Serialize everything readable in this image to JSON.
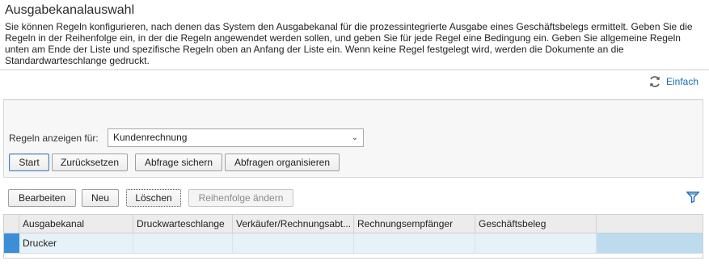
{
  "page": {
    "title": "Ausgabekanalauswahl",
    "description": "Sie können Regeln konfigurieren, nach denen das System den Ausgabekanal für die prozessintegrierte Ausgabe eines Geschäftsbelegs ermittelt. Geben Sie die Regeln in der Reihenfolge ein, in der die Regeln angewendet werden sollen, und geben Sie für jede Regel eine Bedingung ein. Geben Sie allgemeine Regeln unten am Ende der Liste und spezifische Regeln oben an Anfang der Liste ein. Wenn keine Regel festgelegt wird, werden die Dokumente an die Standardwarteschlange gedruckt."
  },
  "simple_link": {
    "label": "Einfach",
    "icon": "refresh-icon"
  },
  "filter": {
    "label": "Regeln anzeigen für:",
    "selected": "Kundenrechnung",
    "buttons": {
      "start": "Start",
      "reset": "Zurücksetzen",
      "save_query": "Abfrage sichern",
      "organize_queries": "Abfragen organisieren"
    }
  },
  "toolbar": {
    "edit": "Bearbeiten",
    "new": "Neu",
    "delete": "Löschen",
    "reorder": "Reihenfolge ändern",
    "filter_icon": "funnel-icon"
  },
  "table": {
    "columns": [
      "Ausgabekanal",
      "Druckwarteschlange",
      "Verkäufer/Rechnungsabt...",
      "Rechnungsempfänger",
      "Geschäftsbeleg"
    ],
    "rows": [
      {
        "cells": [
          "Drucker",
          "",
          "",
          "",
          ""
        ]
      }
    ]
  },
  "colors": {
    "accent": "#1a6cb5",
    "row_selected": "#3c8fd6"
  }
}
